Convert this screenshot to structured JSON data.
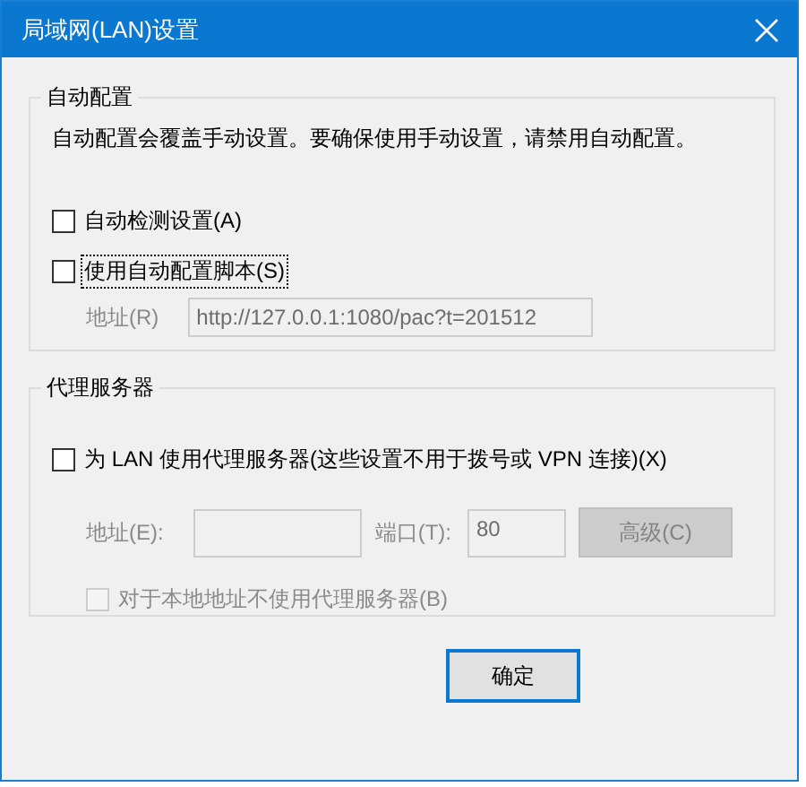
{
  "window": {
    "title": "局域网(LAN)设置"
  },
  "auto_config": {
    "title": "自动配置",
    "description": "自动配置会覆盖手动设置。要确保使用手动设置，请禁用自动配置。",
    "options": [
      {
        "label": "自动检测设置(A)",
        "checked": false,
        "focused": false
      },
      {
        "label": "使用自动配置脚本(S)",
        "checked": false,
        "focused": true
      }
    ],
    "script_address": {
      "label": "地址(R)",
      "value": "http://127.0.0.1:1080/pac?t=201512",
      "disabled": true
    }
  },
  "proxy": {
    "title": "代理服务器",
    "use_proxy": {
      "label": "为 LAN 使用代理服务器(这些设置不用于拨号或 VPN 连接)(X)",
      "checked": false,
      "disabled": false
    },
    "address": {
      "label": "地址(E):",
      "disabled": true
    },
    "port": {
      "label": "端口(T):",
      "value": "80",
      "disabled": true
    },
    "advanced": {
      "label": "高级(C)",
      "disabled": true
    },
    "bypass_local": {
      "label": "对于本地地址不使用代理服务器(B)",
      "checked": false,
      "disabled": true
    }
  },
  "buttons": [
    {
      "label": "确定",
      "default": true
    }
  ]
}
